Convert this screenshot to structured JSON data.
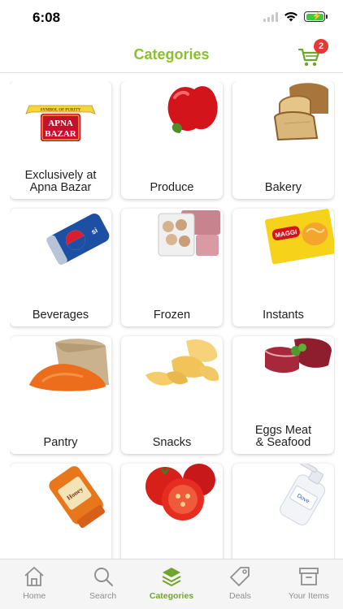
{
  "status": {
    "time": "6:08"
  },
  "header": {
    "title": "Categories",
    "cart_count": "2"
  },
  "categories": [
    {
      "label": "Exclusively at\nApna Bazar",
      "logo_top": "SYMBOL OF PURITY",
      "logo_main": "APNA\nBAZAR"
    },
    {
      "label": "Produce"
    },
    {
      "label": "Bakery"
    },
    {
      "label": "Beverages"
    },
    {
      "label": "Frozen"
    },
    {
      "label": "Instants"
    },
    {
      "label": "Pantry"
    },
    {
      "label": "Snacks"
    },
    {
      "label": "Eggs Meat\n& Seafood"
    },
    {
      "label": ""
    },
    {
      "label": ""
    },
    {
      "label": ""
    }
  ],
  "tabs": [
    {
      "label": "Home",
      "icon": "home-icon"
    },
    {
      "label": "Search",
      "icon": "search-icon"
    },
    {
      "label": "Categories",
      "icon": "layers-icon",
      "active": true
    },
    {
      "label": "Deals",
      "icon": "tag-icon"
    },
    {
      "label": "Your Items",
      "icon": "archive-box-icon"
    }
  ],
  "colors": {
    "accent": "#8cbf2e",
    "active_tab": "#6fa52b",
    "badge": "#e53935"
  }
}
